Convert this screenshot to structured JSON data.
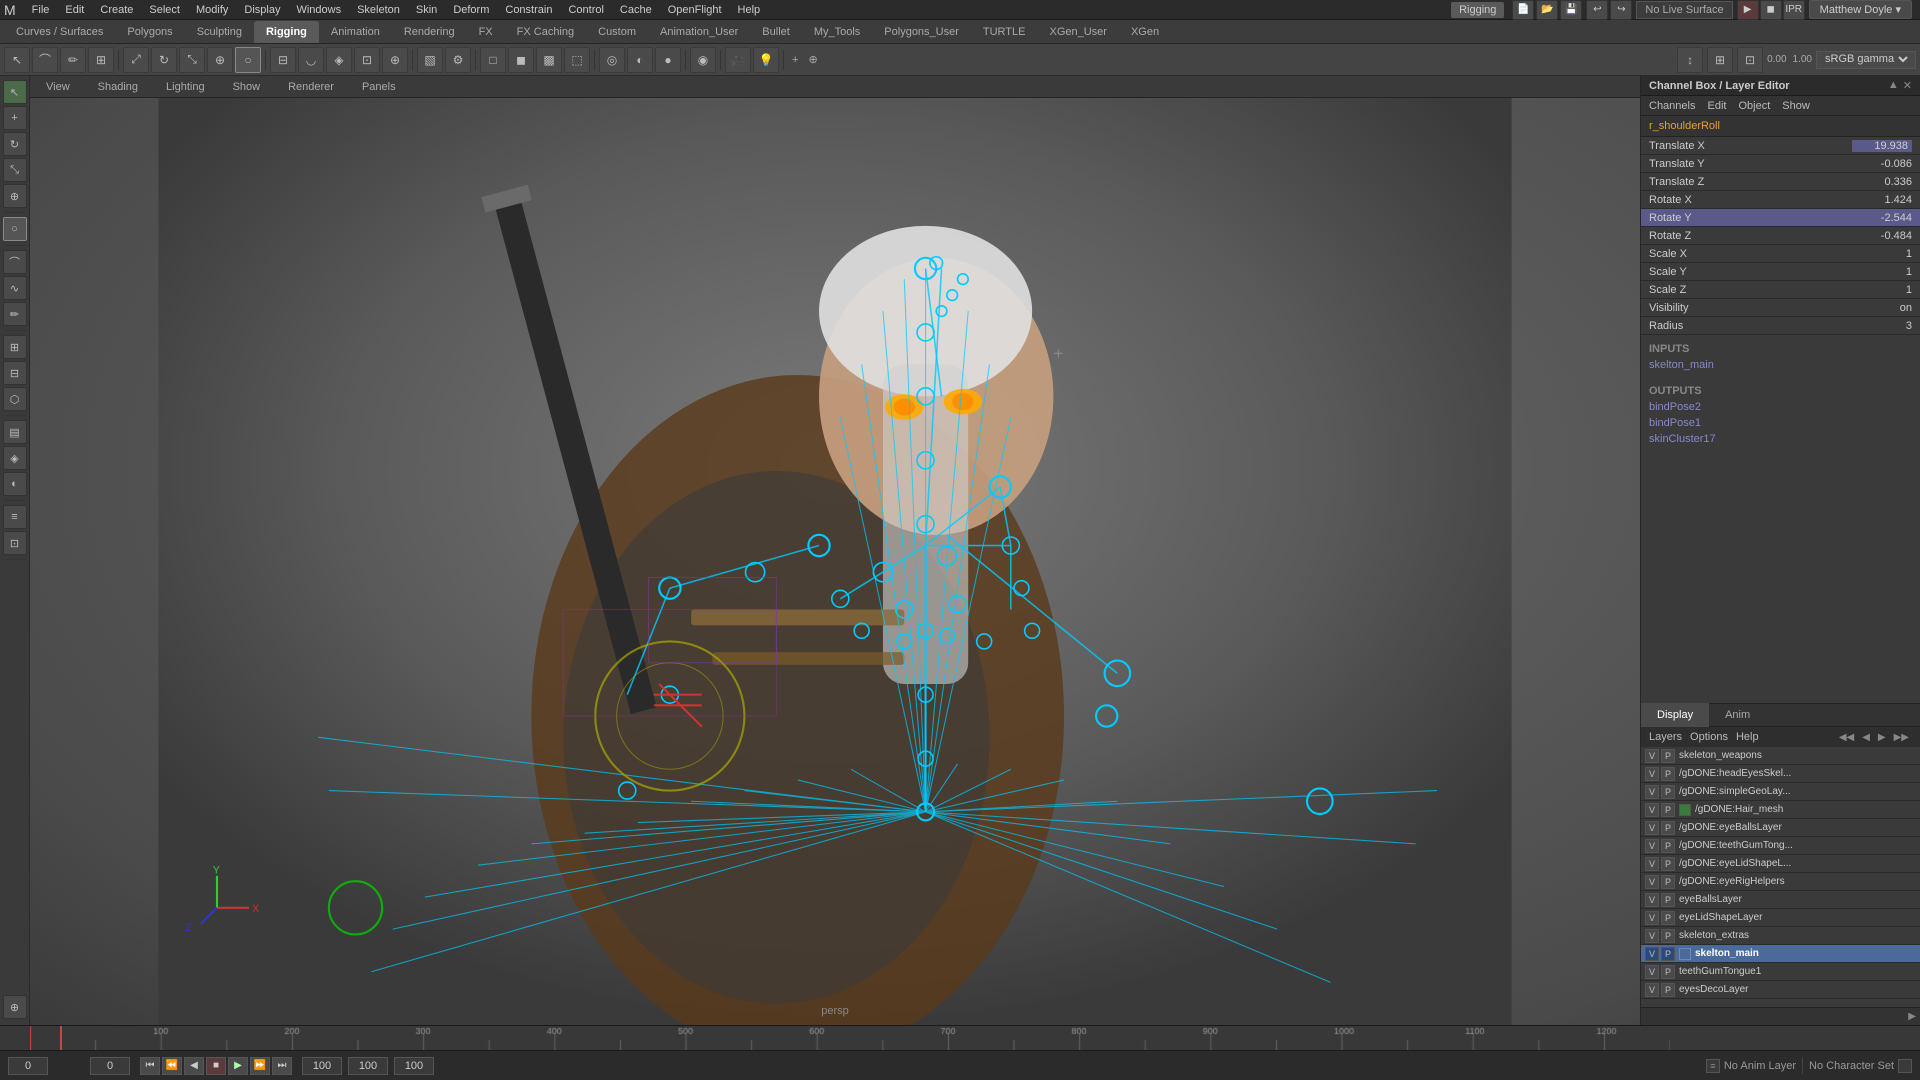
{
  "app": {
    "title": "Autodesk Maya",
    "workspace": "Rigging"
  },
  "menu": {
    "items": [
      "File",
      "Edit",
      "Create",
      "Select",
      "Modify",
      "Display",
      "Windows",
      "Skeleton",
      "Skin",
      "Deform",
      "Constrain",
      "Control",
      "Cache",
      "OpenFlight",
      "Help"
    ]
  },
  "toolbar": {
    "no_live_surface": "No Live Surface",
    "user": "Matthew Doyle ▾"
  },
  "module_tabs": {
    "items": [
      "Curves / Surfaces",
      "Polygons",
      "Sculpting",
      "Rigging",
      "Animation",
      "Rendering",
      "FX",
      "FX Caching",
      "Custom",
      "Animation_User",
      "Bullet",
      "My_Tools",
      "Polygons_User",
      "TURTLE",
      "XGen_User",
      "XGen"
    ],
    "active": "Rigging"
  },
  "renderer_tabs": {
    "items": [
      "View",
      "Shading",
      "Lighting",
      "Show",
      "Renderer",
      "Panels"
    ]
  },
  "viewport": {
    "persp_label": "persp",
    "crosshair": "+"
  },
  "channel_box": {
    "title": "Channel Box / Layer Editor",
    "menu_items": [
      "Channels",
      "Edit",
      "Object",
      "Show"
    ],
    "selected_node": "r_shoulderRoll",
    "channels": [
      {
        "name": "Translate X",
        "value": "19.938",
        "highlight": true
      },
      {
        "name": "Translate Y",
        "value": "-0.086",
        "highlight": false
      },
      {
        "name": "Translate Z",
        "value": "0.336",
        "highlight": false
      },
      {
        "name": "Rotate X",
        "value": "1.424",
        "highlight": false
      },
      {
        "name": "Rotate Y",
        "value": "-2.544",
        "highlight": true
      },
      {
        "name": "Rotate Z",
        "value": "-0.484",
        "highlight": false
      },
      {
        "name": "Scale X",
        "value": "1",
        "highlight": false
      },
      {
        "name": "Scale Y",
        "value": "1",
        "highlight": false
      },
      {
        "name": "Scale Z",
        "value": "1",
        "highlight": false
      },
      {
        "name": "Visibility",
        "value": "on",
        "highlight": false
      },
      {
        "name": "Radius",
        "value": "3",
        "highlight": false
      }
    ],
    "inputs_header": "INPUTS",
    "inputs": [
      "skelton_main"
    ],
    "outputs_header": "OUTPUTS",
    "outputs": [
      "bindPose2",
      "bindPose1",
      "skinCluster17"
    ]
  },
  "display_anim": {
    "tabs": [
      "Display",
      "Anim"
    ],
    "active": "Display"
  },
  "layers_panel": {
    "menu_items": [
      "Layers",
      "Options",
      "Help"
    ],
    "layers": [
      {
        "name": "skeleton_weapons",
        "v": true,
        "p": true,
        "active": false,
        "color": null
      },
      {
        "name": "/gDONE:headEyesSkel...",
        "v": true,
        "p": true,
        "active": false,
        "color": null
      },
      {
        "name": "/gDONE:simpleGeoLay...",
        "v": true,
        "p": true,
        "active": false,
        "color": null
      },
      {
        "name": "/gDONE:Hair_mesh",
        "v": true,
        "p": true,
        "active": false,
        "color": "#3a7a3a"
      },
      {
        "name": "/gDONE:eyeBallsLayer",
        "v": true,
        "p": true,
        "active": false,
        "color": null
      },
      {
        "name": "/gDONE:teethGumTong...",
        "v": true,
        "p": true,
        "active": false,
        "color": null
      },
      {
        "name": "/gDONE:eyeLidShapeL...",
        "v": true,
        "p": true,
        "active": false,
        "color": null
      },
      {
        "name": "/gDONE:eyeRigHelpers",
        "v": true,
        "p": true,
        "active": false,
        "color": null
      },
      {
        "name": "eyeBallsLayer",
        "v": true,
        "p": true,
        "active": false,
        "color": null
      },
      {
        "name": "eyeLidShapeLayer",
        "v": true,
        "p": true,
        "active": false,
        "color": null
      },
      {
        "name": "skeleton_extras",
        "v": true,
        "p": true,
        "active": false,
        "color": null
      },
      {
        "name": "skelton_main",
        "v": true,
        "p": true,
        "active": true,
        "color": "#3a6a9a"
      },
      {
        "name": "teethGumTongue1",
        "v": true,
        "p": true,
        "active": false,
        "color": null
      },
      {
        "name": "eyesDecoLayer",
        "v": true,
        "p": true,
        "active": false,
        "color": null
      }
    ]
  },
  "timeline": {
    "start_frame": "0",
    "current_frame": "0",
    "end_frame": "100",
    "range_start": "100",
    "range_end": "100",
    "total_frames": "1250"
  },
  "bottom_bar": {
    "frame_display": "0",
    "anim_layer": "No Anim Layer",
    "char_set": "No Character Set",
    "frame_values": [
      "0",
      "0",
      "0",
      "100",
      "100",
      "100"
    ]
  },
  "left_toolbar": {
    "tools": [
      {
        "icon": "↖",
        "name": "select-tool"
      },
      {
        "icon": "Q",
        "name": "move-tool"
      },
      {
        "icon": "↕",
        "name": "scale-tool"
      },
      {
        "icon": "↻",
        "name": "rotate-tool"
      },
      {
        "icon": "⊕",
        "name": "universal-manip"
      },
      {
        "icon": "○",
        "name": "soft-mod"
      },
      {
        "icon": "⊞",
        "name": "lattice"
      },
      {
        "icon": "▤",
        "name": "layer-editor"
      },
      {
        "icon": "≡",
        "name": "attribute-editor"
      },
      {
        "icon": "⊡",
        "name": "graph-editor"
      }
    ]
  },
  "icons": {
    "close": "✕",
    "minimize": "─",
    "maximize": "□",
    "arrow_left": "◀",
    "arrow_right": "▶",
    "play": "▶",
    "play_back": "◀",
    "skip_back": "⏮",
    "skip_fwd": "⏭",
    "step_back": "⏪",
    "step_fwd": "⏩",
    "record": "⏺"
  }
}
